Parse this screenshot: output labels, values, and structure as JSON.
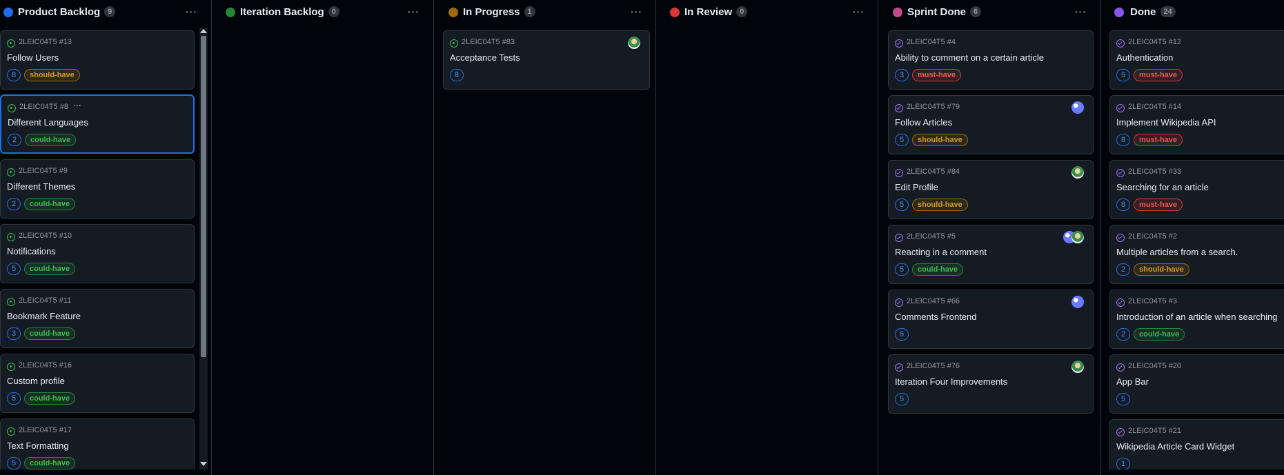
{
  "columns": [
    {
      "name": "Product Backlog",
      "count": "9",
      "color": "#1f6feb"
    },
    {
      "name": "Iteration Backlog",
      "count": "0",
      "color": "#238636"
    },
    {
      "name": "In Progress",
      "count": "1",
      "color": "#9e6a03"
    },
    {
      "name": "In Review",
      "count": "0",
      "color": "#da3633"
    },
    {
      "name": "Sprint Done",
      "count": "6",
      "color": "#bf4b8a"
    },
    {
      "name": "Done",
      "count": "24",
      "color": "#8957e5"
    }
  ],
  "more_glyph": "···",
  "cards": {
    "backlog": [
      {
        "ref": "2LEIC04T5 #13",
        "title": "Follow Users",
        "estimate": "8",
        "label": "should-have"
      },
      {
        "ref": "2LEIC04T5 #8",
        "title": "Different Languages",
        "estimate": "2",
        "label": "could-have"
      },
      {
        "ref": "2LEIC04T5 #9",
        "title": "Different Themes",
        "estimate": "2",
        "label": "could-have"
      },
      {
        "ref": "2LEIC04T5 #10",
        "title": "Notifications",
        "estimate": "5",
        "label": "could-have"
      },
      {
        "ref": "2LEIC04T5 #11",
        "title": "Bookmark Feature",
        "estimate": "3",
        "label": "could-have"
      },
      {
        "ref": "2LEIC04T5 #16",
        "title": "Custom profile",
        "estimate": "5",
        "label": "could-have"
      },
      {
        "ref": "2LEIC04T5 #17",
        "title": "Text Formatting",
        "estimate": "5",
        "label": "could-have"
      }
    ],
    "in_progress": [
      {
        "ref": "2LEIC04T5 #83",
        "title": "Acceptance Tests",
        "estimate": "8"
      }
    ],
    "sprint_done": [
      {
        "ref": "2LEIC04T5 #4",
        "title": "Ability to comment on a certain article",
        "estimate": "3",
        "label": "must-have"
      },
      {
        "ref": "2LEIC04T5 #79",
        "title": "Follow Articles",
        "estimate": "5",
        "label": "should-have"
      },
      {
        "ref": "2LEIC04T5 #84",
        "title": "Edit Profile",
        "estimate": "5",
        "label": "should-have"
      },
      {
        "ref": "2LEIC04T5 #5",
        "title": "Reacting in a comment",
        "estimate": "5",
        "label": "could-have"
      },
      {
        "ref": "2LEIC04T5 #66",
        "title": "Comments Frontend",
        "estimate": "5"
      },
      {
        "ref": "2LEIC04T5 #76",
        "title": "Iteration Four Improvements",
        "estimate": "5"
      }
    ],
    "done": [
      {
        "ref": "2LEIC04T5 #12",
        "title": "Authentication",
        "estimate": "5",
        "label": "must-have"
      },
      {
        "ref": "2LEIC04T5 #14",
        "title": "Implement Wikipedia API",
        "estimate": "8",
        "label": "must-have"
      },
      {
        "ref": "2LEIC04T5 #33",
        "title": "Searching for an article",
        "estimate": "8",
        "label": "must-have"
      },
      {
        "ref": "2LEIC04T5 #2",
        "title": "Multiple articles from a search.",
        "estimate": "2",
        "label": "should-have"
      },
      {
        "ref": "2LEIC04T5 #3",
        "title": "Introduction of an article when searching",
        "estimate": "2",
        "label": "could-have"
      },
      {
        "ref": "2LEIC04T5 #20",
        "title": "App Bar",
        "estimate": "5"
      },
      {
        "ref": "2LEIC04T5 #21",
        "title": "Wikipedia Article Card Widget",
        "estimate": "1"
      }
    ]
  }
}
